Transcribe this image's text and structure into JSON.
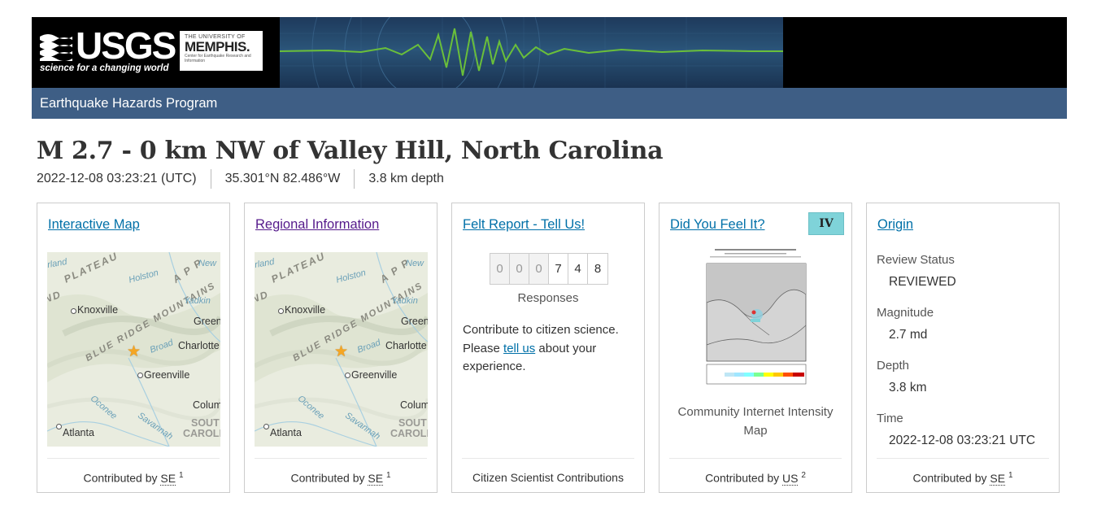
{
  "header": {
    "usgs_word": "USGS",
    "usgs_tagline": "science for a changing world",
    "memphis_line1": "THE UNIVERSITY OF",
    "memphis_line2": "MEMPHIS.",
    "memphis_line3": "Center for Earthquake Research and Information",
    "nav_title": "Earthquake Hazards Program"
  },
  "event": {
    "title": "M 2.7 - 0 km NW of Valley Hill, North Carolina",
    "time": "2022-12-08 03:23:21 (UTC)",
    "location": "35.301°N 82.486°W",
    "depth": "3.8 km depth"
  },
  "map_labels": {
    "plateau": "PLATEAU",
    "appalachian": "A P P",
    "blue_ridge": "BLUE RIDGE MOUNTAINS",
    "knoxville": "Knoxville",
    "green": "Green",
    "charlotte": "Charlotte",
    "greenville": "Greenville",
    "columbia": "Colum",
    "atlanta": "Atlanta",
    "south_carolina_1": "SOUT",
    "south_carolina_2": "CAROLI",
    "holston": "Holston",
    "yadkin": "Yadkin",
    "broad": "Broad",
    "oconee": "Oconee",
    "savannah": "Savannah",
    "nd": "ND",
    "rland": "rland",
    "new": "New"
  },
  "cards": [
    {
      "title": "Interactive Map",
      "foot_prefix": "Contributed by",
      "foot_network": "SE",
      "foot_sup": "1"
    },
    {
      "title": "Regional Information",
      "foot_prefix": "Contributed by",
      "foot_network": "SE",
      "foot_sup": "1"
    },
    {
      "title": "Felt Report - Tell Us!",
      "digits": [
        "0",
        "0",
        "0",
        "7",
        "4",
        "8"
      ],
      "responses_label": "Responses",
      "text_before_link": "Contribute to citizen science. Please ",
      "link_text": "tell us",
      "text_after_link": " about your experience.",
      "foot_text": "Citizen Scientist Contributions"
    },
    {
      "title": "Did You Feel It?",
      "badge": "IV",
      "badge_color": "#7fd3d9",
      "caption": "Community Internet Intensity Map",
      "foot_prefix": "Contributed by",
      "foot_network": "US",
      "foot_sup": "2"
    },
    {
      "title": "Origin",
      "review_status_label": "Review Status",
      "review_status_value": "REVIEWED",
      "magnitude_label": "Magnitude",
      "magnitude_value": "2.7 md",
      "depth_label": "Depth",
      "depth_value": "3.8 km",
      "time_label": "Time",
      "time_value": "2022-12-08 03:23:21 UTC",
      "foot_prefix": "Contributed by",
      "foot_network": "SE",
      "foot_sup": "1"
    }
  ],
  "colors": {
    "nav_bar": "#3e5e85",
    "link": "#0070a8",
    "visited_link": "#551a8b",
    "epicenter_star": "#f5a623",
    "seismogram": "#6abf3a"
  }
}
